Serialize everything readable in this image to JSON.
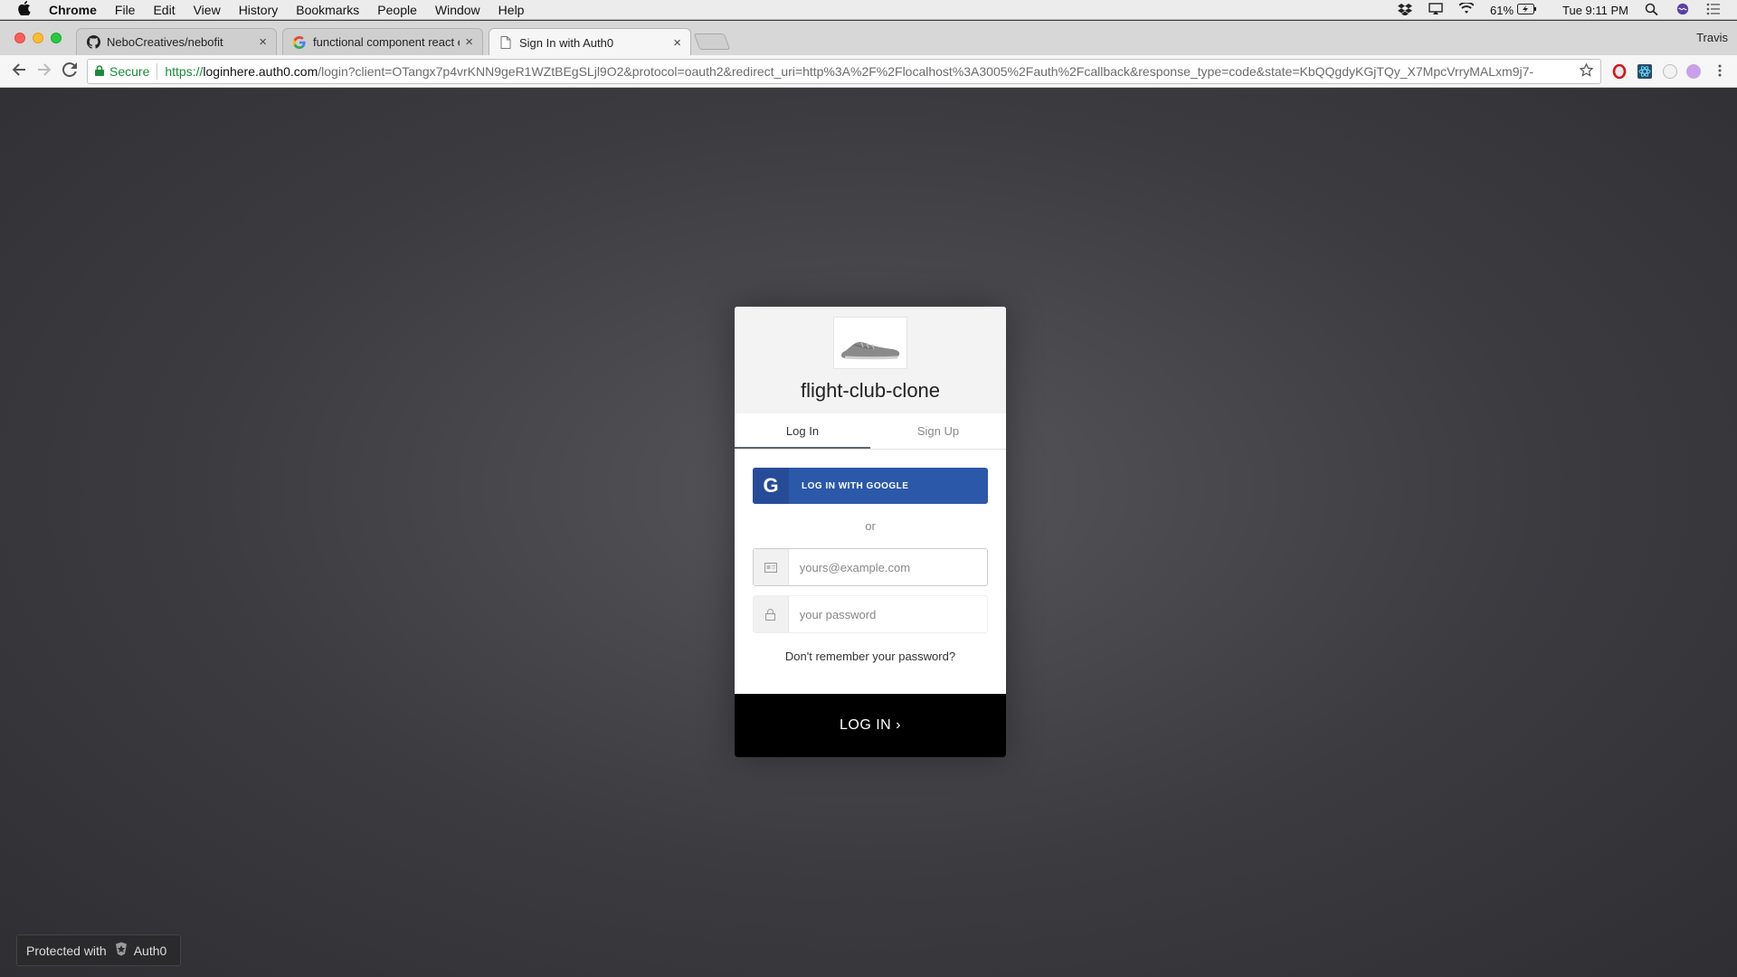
{
  "menubar": {
    "app_name": "Chrome",
    "items": [
      "File",
      "Edit",
      "View",
      "History",
      "Bookmarks",
      "People",
      "Window",
      "Help"
    ],
    "battery": "61%",
    "clock": "Tue 9:11 PM"
  },
  "tabs": [
    {
      "title": "NeboCreatives/nebofit",
      "icon": "github-icon",
      "close": "×"
    },
    {
      "title": "functional component react ex",
      "icon": "google-icon",
      "close": "×"
    },
    {
      "title": "Sign In with Auth0",
      "icon": "document-icon",
      "close": "×"
    }
  ],
  "profile_name": "Travis",
  "omnibox": {
    "security_label": "Secure",
    "url_scheme": "https://",
    "url_host": "loginhere.auth0.com",
    "url_rest": "/login?client=OTangx7p4vrKNN9geR1WZtBEgSLjl9O2&protocol=oauth2&redirect_uri=http%3A%2F%2Flocalhost%3A3005%2Fauth%2Fcallback&response_type=code&state=KbQQgdyKGjTQy_X7MpcVrryMALxm9j7-"
  },
  "lock": {
    "title": "flight-club-clone",
    "tabs": {
      "login": "Log In",
      "signup": "Sign Up"
    },
    "google_button": "LOG IN WITH GOOGLE",
    "google_letter": "G",
    "or": "or",
    "email_placeholder": "yours@example.com",
    "password_placeholder": "your password",
    "forgot": "Don't remember your password?",
    "submit": "LOG IN ›"
  },
  "badge": {
    "prefix": "Protected with",
    "brand": "Auth0"
  }
}
